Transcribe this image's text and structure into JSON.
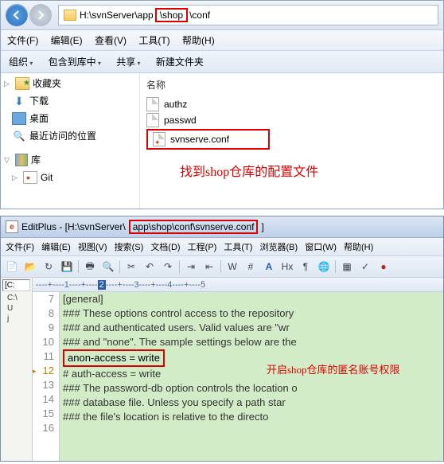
{
  "explorer": {
    "address_prefix": "H:\\svnServer\\app",
    "address_highlight": "\\shop",
    "address_suffix": "\\conf",
    "menu": {
      "file": "文件(F)",
      "edit": "编辑(E)",
      "view": "查看(V)",
      "tools": "工具(T)",
      "help": "帮助(H)"
    },
    "toolbar": {
      "organize": "组织",
      "include": "包含到库中",
      "share": "共享",
      "newfolder": "新建文件夹"
    },
    "sidebar": {
      "favorites": "收藏夹",
      "downloads": "下载",
      "desktop": "桌面",
      "recent": "最近访问的位置",
      "libraries": "库",
      "git": "Git"
    },
    "col_name": "名称",
    "files": [
      "authz",
      "passwd",
      "svnserve.conf"
    ],
    "annotation": "找到shop仓库的配置文件"
  },
  "editplus": {
    "title_prefix": "EditPlus - [H:\\svnServer\\",
    "title_highlight": "app\\shop\\conf\\svnserve.conf",
    "title_suffix": "]",
    "menu": {
      "file": "文件(F)",
      "edit": "编辑(E)",
      "view": "视图(V)",
      "search": "搜索(S)",
      "doc": "文档(D)",
      "project": "工程(P)",
      "tools": "工具(T)",
      "browser": "浏览器(B)",
      "window": "窗口(W)",
      "help": "帮助(H)"
    },
    "drive": "[C:",
    "dirs": [
      "C:\\",
      "U",
      "j"
    ],
    "ruler_a": "----+----",
    "ruler_b": "1",
    "ruler_c": "----+----",
    "ruler_cursor": "2",
    "ruler_d": "----+----3----+----4----+----5",
    "code": {
      "l7": "",
      "l8": "[general]",
      "l9": "### These options control access to the repository",
      "l10": "### and authenticated users.  Valid values are \"wr",
      "l11": "### and \"none\".  The sample settings below are the",
      "l12": "anon-access = write",
      "l13": "# auth-access = write",
      "l14": "### The password-db option controls the location o",
      "l15": "### database file.  Unless you specify a path star",
      "l16": "### the file's location is relative to the directo"
    },
    "annotation": "开启shop仓库的匿名账号权限"
  }
}
